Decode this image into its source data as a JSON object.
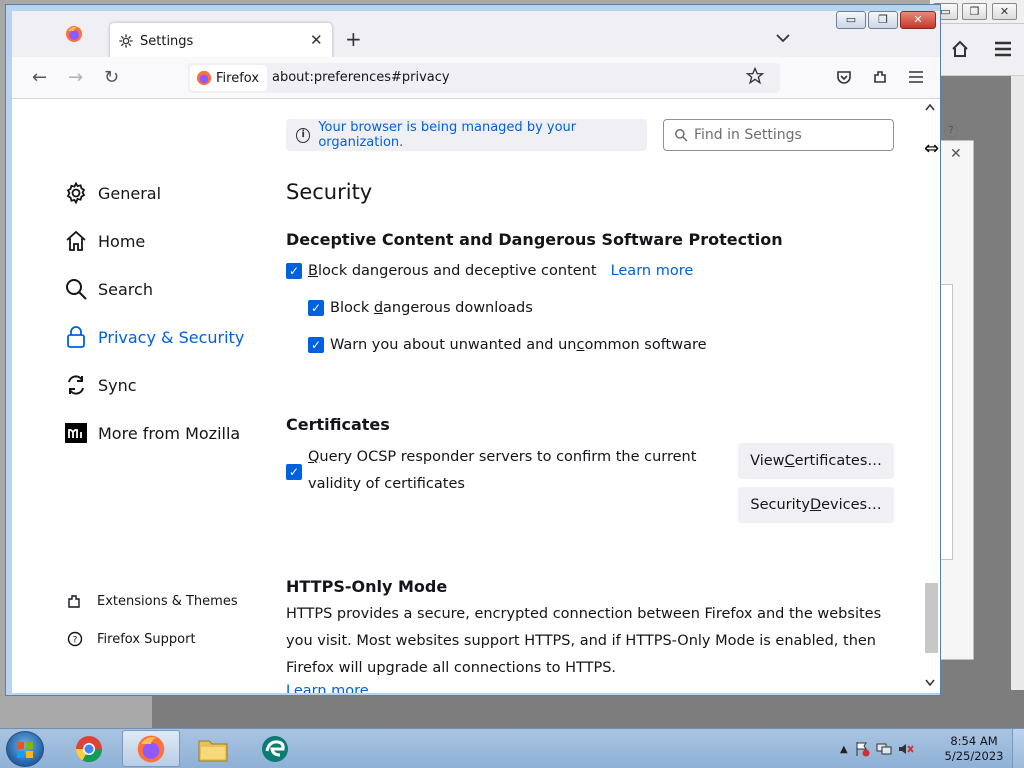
{
  "window": {
    "tab_title": "Settings",
    "minimize_label": "▭",
    "restore_label": "❐",
    "close_label": "✕"
  },
  "navbar": {
    "identity_label": "Firefox",
    "url": "about:preferences#privacy"
  },
  "banner": {
    "policies_text": "Your browser is being managed by your organization.",
    "search_placeholder": "Find in Settings"
  },
  "sidebar": {
    "categories": [
      {
        "label": "General",
        "icon": "gear-icon"
      },
      {
        "label": "Home",
        "icon": "home-icon"
      },
      {
        "label": "Search",
        "icon": "search-icon"
      },
      {
        "label": "Privacy & Security",
        "icon": "lock-icon",
        "selected": true
      },
      {
        "label": "Sync",
        "icon": "sync-icon"
      },
      {
        "label": "More from Mozilla",
        "icon": "mozilla-icon"
      }
    ],
    "footer": [
      {
        "label": "Extensions & Themes",
        "icon": "puzzle-icon"
      },
      {
        "label": "Firefox Support",
        "icon": "help-icon"
      }
    ]
  },
  "main": {
    "section_title": "Security",
    "deceptive": {
      "heading": "Deceptive Content and Dangerous Software Protection",
      "block_dangerous_a": "B",
      "block_dangerous_b": "lock dangerous and deceptive content",
      "learn_more": "Learn more",
      "downloads_a": "Block ",
      "downloads_b": "d",
      "downloads_c": "angerous downloads",
      "unwanted_a": "Warn you about unwanted and un",
      "unwanted_b": "c",
      "unwanted_c": "ommon software"
    },
    "certificates": {
      "heading": "Certificates",
      "ocsp_a": "Q",
      "ocsp_b": "uery OCSP responder servers to confirm the current validity of certificates",
      "view_a": "View ",
      "view_b": "C",
      "view_c": "ertificates…",
      "devices_a": "Security ",
      "devices_b": "D",
      "devices_c": "evices…"
    },
    "https": {
      "heading": "HTTPS-Only Mode",
      "description": "HTTPS provides a secure, encrypted connection between Firefox and the websites you visit. Most websites support HTTPS, and if HTTPS-Only Mode is enabled, then Firefox will upgrade all connections to HTTPS.",
      "learn_more": "Learn more"
    }
  },
  "taskbar": {
    "time": "8:54 AM",
    "date": "5/25/2023",
    "apps": [
      "chrome-icon",
      "firefox-icon",
      "file-explorer-icon",
      "edge-icon"
    ]
  },
  "colors": {
    "accent": "#0061e0",
    "checkbox": "#0061e0",
    "taskbar": "#a9c4e1"
  }
}
